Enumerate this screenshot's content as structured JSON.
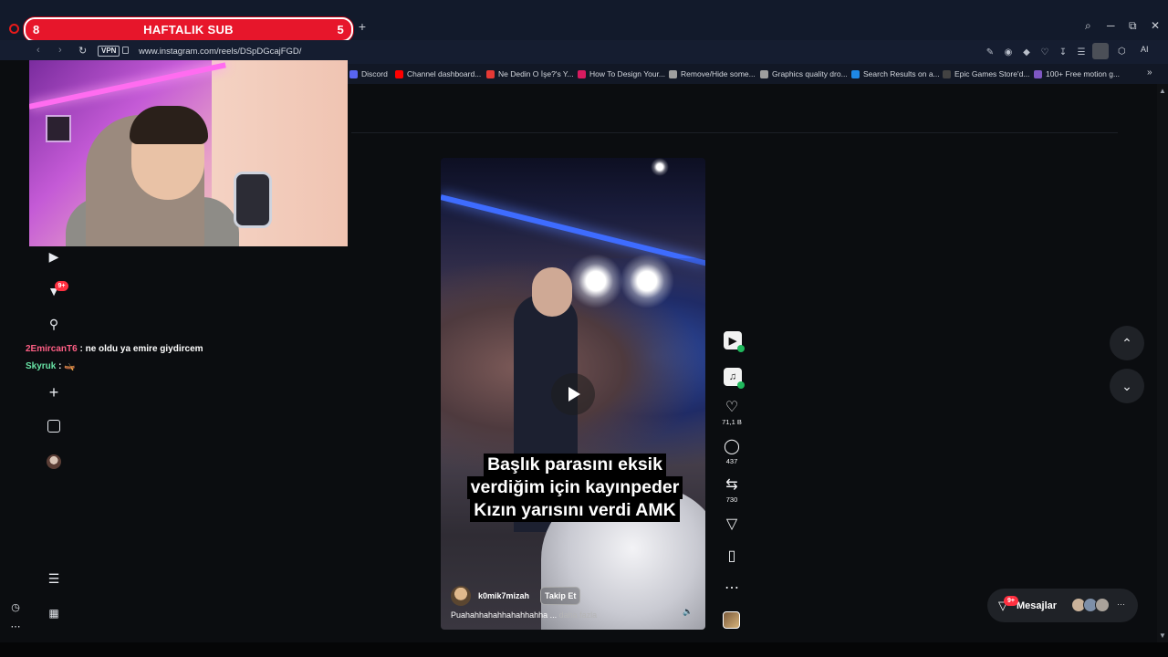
{
  "overlay": {
    "title": "HAFTALIK SUB",
    "left_count": "8",
    "right_count": "5"
  },
  "browser": {
    "url": "www.instagram.com/reels/DSpDGcajFGD/",
    "vpn_label": "VPN",
    "ai_label": "AI",
    "new_tab": "+",
    "window_controls": [
      "⌕",
      "─",
      "⧉",
      "✕"
    ]
  },
  "bookmarks": [
    {
      "label": "Discord",
      "color": "#5865f2"
    },
    {
      "label": "Channel dashboard...",
      "color": "#ff0000"
    },
    {
      "label": "Ne Dedin O İşe?'s Y...",
      "color": "#e53935"
    },
    {
      "label": "How To Design Your...",
      "color": "#d81b60"
    },
    {
      "label": "Remove/Hide some...",
      "color": "#9e9e9e"
    },
    {
      "label": "Graphics quality dro...",
      "color": "#9e9e9e"
    },
    {
      "label": "Search Results on a...",
      "color": "#1e88e5"
    },
    {
      "label": "Epic Games Store'd...",
      "color": "#424242"
    },
    {
      "label": "100+ Free motion g...",
      "color": "#7e57c2"
    }
  ],
  "sidebar": {
    "icons": [
      "reels-icon",
      "direct-icon",
      "search-icon",
      "create-icon",
      "insights-icon",
      "profile-icon",
      "menu-icon",
      "more-apps-icon"
    ],
    "notification_badge": "9+"
  },
  "chat": [
    {
      "user": "2EmircanT6",
      "message": "ne oldu ya emire giydircem"
    },
    {
      "user": "Skyruk",
      "message": "🛶"
    }
  ],
  "reel": {
    "caption_lines": [
      "Başlık parasını eksik",
      "verdiğim için kayınpeder",
      "Kızın yarısını verdi AMK"
    ],
    "username": "k0mik7mizah",
    "follow_label": "Takip Et",
    "description": "Puahahhahahhahahhahha ...",
    "more_label": "daha fazla",
    "likes": "71,1 B",
    "comments": "437",
    "reposts": "730"
  },
  "messages": {
    "label": "Mesajlar",
    "badge": "9+"
  }
}
